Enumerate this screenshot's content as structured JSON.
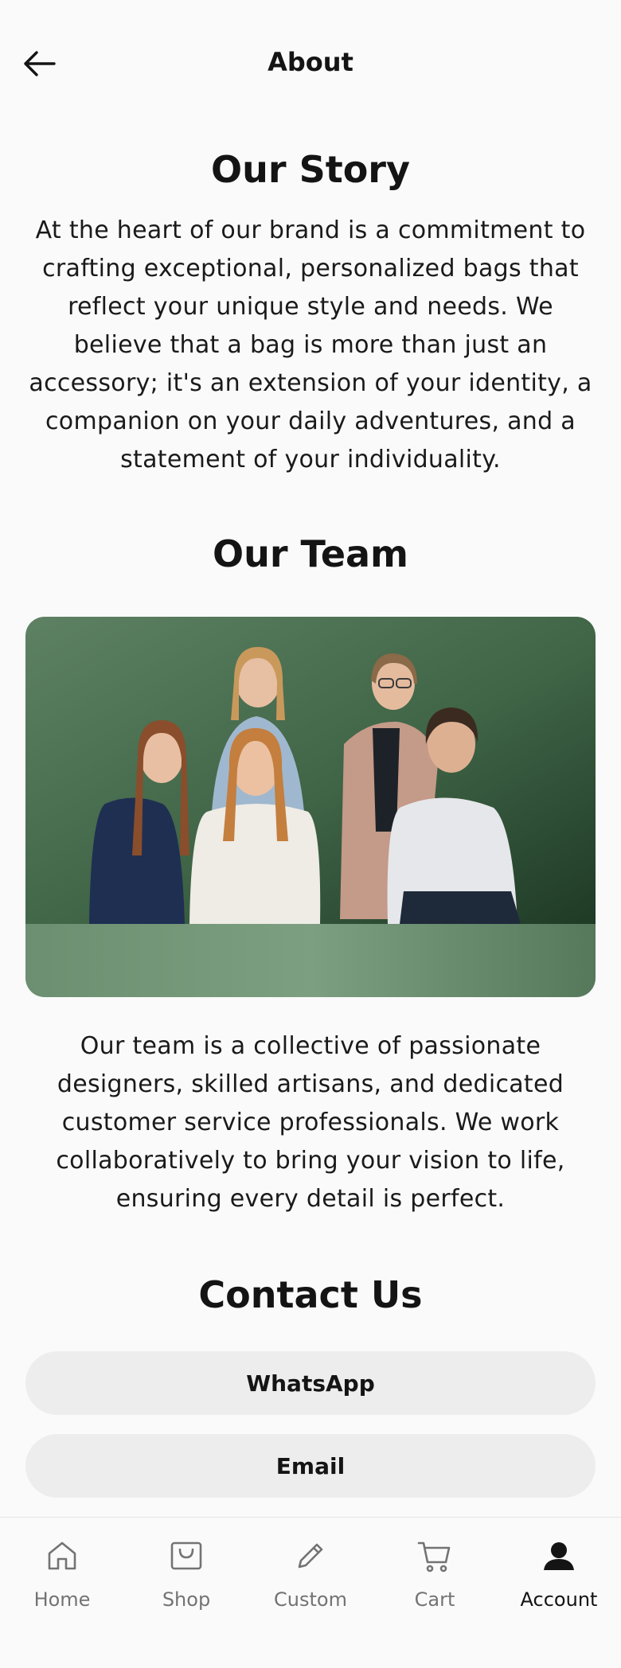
{
  "header": {
    "title": "About"
  },
  "story": {
    "title": "Our Story",
    "lines": [
      "At the heart of our brand is a commitment to",
      "crafting exceptional, personalized bags that",
      "reflect your unique style and needs. We",
      "believe that a bag is more than just an",
      "accessory; it's an extension of your identity, a",
      "companion on your daily adventures, and a",
      "statement of your individuality."
    ]
  },
  "team": {
    "title": "Our Team",
    "lines": [
      "Our team is a collective of passionate",
      "designers, skilled artisans, and dedicated",
      "customer service professionals. We work",
      "collaboratively to bring your vision to life,",
      "ensuring every detail is perfect."
    ]
  },
  "contact": {
    "title": "Contact Us",
    "whatsapp_label": "WhatsApp",
    "email_label": "Email"
  },
  "nav": {
    "items": [
      {
        "label": "Home",
        "icon": "home-icon"
      },
      {
        "label": "Shop",
        "icon": "shopping-bag-icon"
      },
      {
        "label": "Custom",
        "icon": "pencil-icon"
      },
      {
        "label": "Cart",
        "icon": "cart-icon"
      },
      {
        "label": "Account",
        "icon": "user-icon",
        "active": true
      }
    ]
  },
  "colors": {
    "background": "#fafafa",
    "button_bg": "#ededed",
    "photo_backdrop": "#4f7356",
    "text": "#141414",
    "nav_inactive": "#737373"
  }
}
